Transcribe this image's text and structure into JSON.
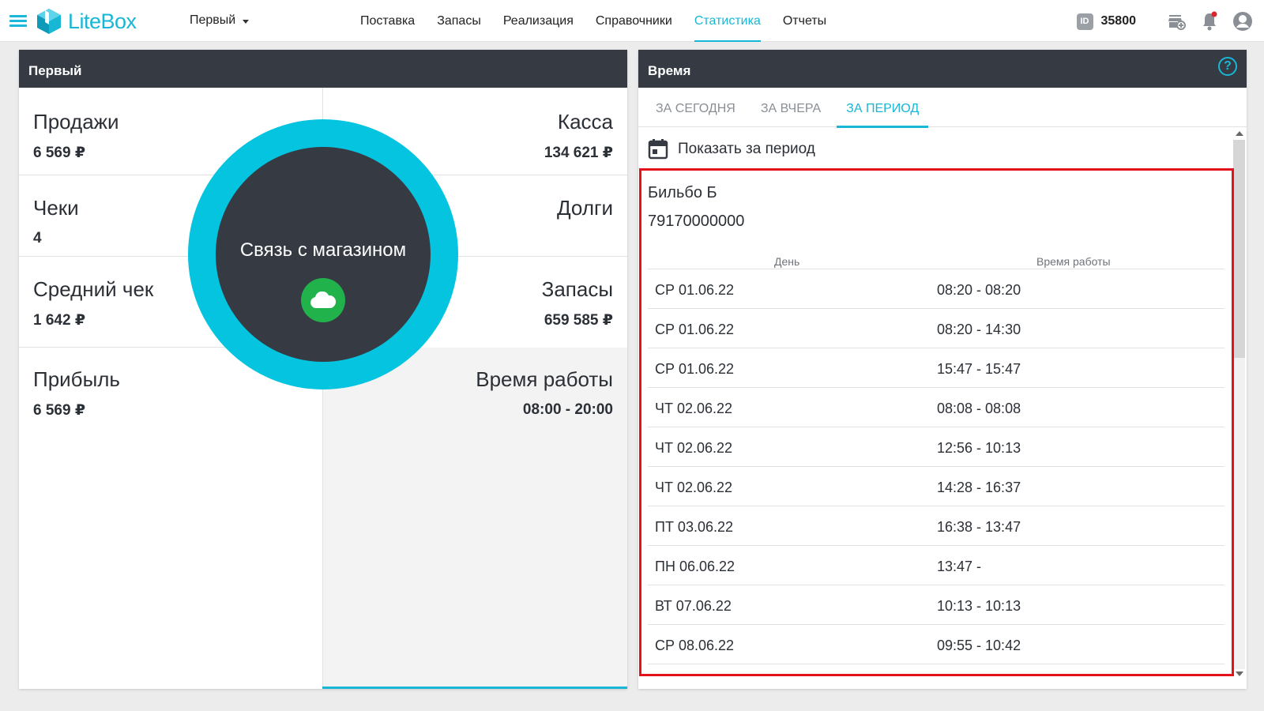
{
  "header": {
    "logo_text": "LiteBox",
    "store": "Первый",
    "menu": [
      "Поставка",
      "Запасы",
      "Реализация",
      "Справочники",
      "Статистика",
      "Отчеты"
    ],
    "active_menu": "Статистика",
    "id_badge": "ID",
    "id_value": "35800",
    "accent": "#18b7d6"
  },
  "left_card": {
    "title": "Первый",
    "sales_title": "Продажи",
    "sales_value": "6 569 ₽",
    "cashbox_title": "Касса",
    "cashbox_value": "134 621 ₽",
    "checks_title": "Чеки",
    "checks_value": "4",
    "debts_title": "Долги",
    "avg_check_title": "Средний чек",
    "avg_check_value": "1 642 ₽",
    "stock_title": "Запасы",
    "stock_value": "659 585 ₽",
    "profit_title": "Прибыль",
    "profit_value": "6 569 ₽",
    "work_time_title": "Время работы",
    "work_time_value": "08:00 - 20:00"
  },
  "overlay": {
    "label": "Связь с магазином",
    "icon": "cloud-icon"
  },
  "right_card": {
    "title": "Время",
    "help": "?",
    "tabs": [
      "ЗА СЕГОДНЯ",
      "ЗА ВЧЕРА",
      "ЗА ПЕРИОД"
    ],
    "active_tab": "ЗА ПЕРИОД",
    "period_label": "Показать за период",
    "employee_name": "Бильбо Б",
    "employee_phone": "79170000000",
    "columns": [
      "День",
      "Время работы"
    ],
    "rows": [
      {
        "day": "СР 01.06.22",
        "time": "08:20 - 08:20"
      },
      {
        "day": "СР 01.06.22",
        "time": "08:20 - 14:30"
      },
      {
        "day": "СР 01.06.22",
        "time": "15:47 - 15:47"
      },
      {
        "day": "ЧТ 02.06.22",
        "time": "08:08 - 08:08"
      },
      {
        "day": "ЧТ 02.06.22",
        "time": "12:56 - 10:13"
      },
      {
        "day": "ЧТ 02.06.22",
        "time": "14:28 - 16:37"
      },
      {
        "day": "ПТ 03.06.22",
        "time": "16:38 - 13:47"
      },
      {
        "day": "ПН 06.06.22",
        "time": "13:47 -"
      },
      {
        "day": "ВТ 07.06.22",
        "time": "10:13 - 10:13"
      },
      {
        "day": "СР 08.06.22",
        "time": "09:55 - 10:42"
      }
    ],
    "highlight_color": "#e5121b"
  }
}
